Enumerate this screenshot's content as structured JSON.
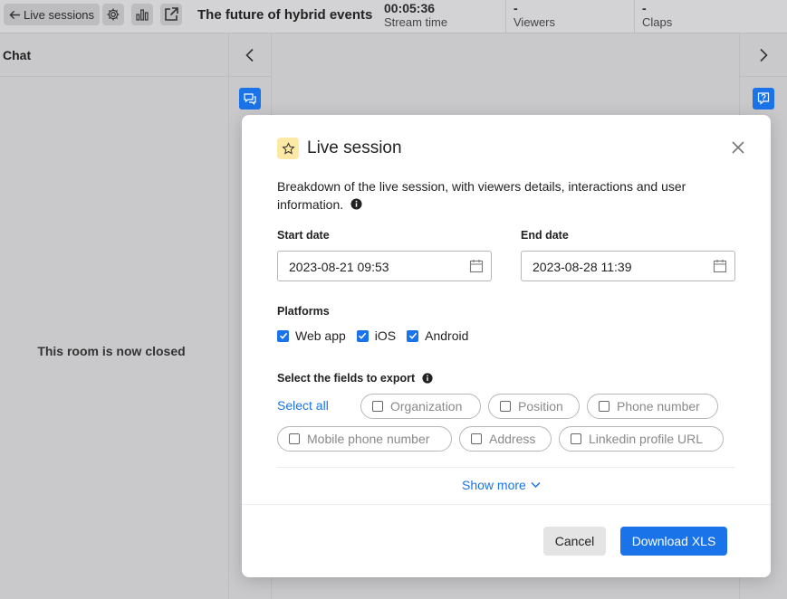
{
  "topbar": {
    "back_label": "Live sessions",
    "event_title": "The future of hybrid events",
    "stats": [
      {
        "value": "00:05:36",
        "label": "Stream time"
      },
      {
        "value": "-",
        "label": "Viewers"
      },
      {
        "value": "-",
        "label": "Claps"
      }
    ]
  },
  "chat": {
    "header": "Chat",
    "closed_message": "This room is now closed"
  },
  "modal": {
    "title": "Live session",
    "description": "Breakdown of the live session, with viewers details, interactions and user information.",
    "start_label": "Start date",
    "start_value": "2023-08-21 09:53",
    "end_label": "End date",
    "end_value": "2023-08-28 11:39",
    "platforms_label": "Platforms",
    "platforms": [
      {
        "label": "Web app",
        "checked": true
      },
      {
        "label": "iOS",
        "checked": true
      },
      {
        "label": "Android",
        "checked": true
      }
    ],
    "fields_label": "Select the fields to export",
    "select_all": "Select all",
    "fields": [
      {
        "label": "Organization",
        "checked": false
      },
      {
        "label": "Position",
        "checked": false
      },
      {
        "label": "Phone number",
        "checked": false
      },
      {
        "label": "Mobile phone number",
        "checked": false
      },
      {
        "label": "Address",
        "checked": false
      },
      {
        "label": "Linkedin profile URL",
        "checked": false
      }
    ],
    "show_more": "Show more",
    "cancel": "Cancel",
    "download": "Download XLS"
  },
  "colors": {
    "accent": "#1a73e8",
    "star_badge": "#fde9a6"
  }
}
